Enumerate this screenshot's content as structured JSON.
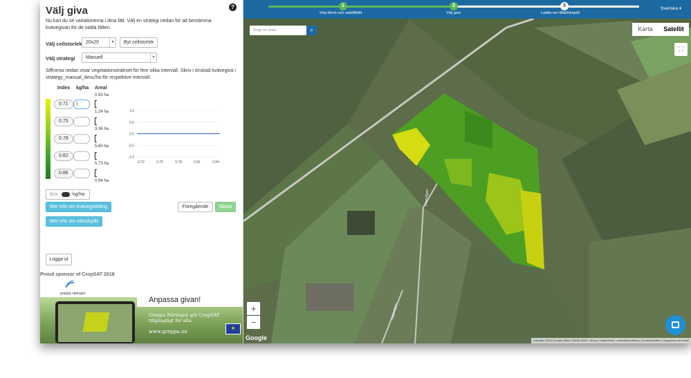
{
  "left": {
    "title": "Välj giva",
    "intro": "Nu kan du se variationerna i dina fält. Välj en strategi nedan för att bestämma kvävegivan för de valda fälten.",
    "cellsize_label": "Välj cellstorlek",
    "cellsize_value": "20x20",
    "change_cellsize_button": "Byt cellstorlek",
    "strategy_label": "Välj strategi",
    "strategy_value": "Manuell",
    "description": "Siffrorna nedan visar vegetationsindexet för fem olika intervall. Skriv i önskad kvävegiva i strategy_manual_desc/ha för respektive intervall.",
    "col_index": "Index",
    "col_kgha": "kg/ha",
    "col_areal": "Areal",
    "indexes": [
      "0.71",
      "0.75",
      "0.78",
      "0.82",
      "0.86"
    ],
    "areas": [
      "0.93 ha",
      "1.24 ha",
      "3.36 ha",
      "5.60 ha",
      "5.73 ha",
      "0.94 ha"
    ],
    "toggle_left": "lb/a",
    "toggle_right": "kg/ha",
    "more_info_n": "Mer info om kvävegödsling",
    "more_info_growth": "Mer info om växtskydd",
    "prev_button": "Föregående",
    "next_button": "Nästa",
    "logout_button": "Logga ut",
    "sponsor": "Proud sponsor of CropSAT 2018",
    "logo_text": "greppa näringen",
    "banner_title": "Anpassa givan!",
    "banner_sub": "Greppa Näringen gör CropSAT tillgängligt för alla.",
    "banner_url": "www.greppa.nu"
  },
  "chart_data": {
    "type": "line",
    "x": [
      "0.72",
      "0.75",
      "0.78",
      "0.81",
      "0.84"
    ],
    "y_ticks": [
      "1.0",
      "0.5",
      "0.0",
      "-0.5",
      "-1.0"
    ],
    "ylim": [
      -1.0,
      1.0
    ],
    "values": [
      0,
      0,
      0,
      0,
      0
    ],
    "line_color": "#2c5fbf"
  },
  "map": {
    "steps": [
      {
        "num": "1",
        "label": "Visa block och satellitbild"
      },
      {
        "num": "2",
        "label": "Välj giva"
      },
      {
        "num": "3",
        "label": "Ladda ner tilldelningsfil"
      }
    ],
    "language": "Svenska ▾",
    "search_placeholder": "Ange en plats",
    "map_type_map": "Karta",
    "map_type_satellite": "Satellit",
    "zoom_in": "+",
    "zoom_out": "−",
    "google": "Google",
    "attribution": "Kartdata ©2018 Google Bilder ©2018 CNES / Airbus, DigitalGlobe, Lantmäteriet/Metria | Användarvillkor | Rapportera ett kartfel",
    "road_label_1": "Linyrvägen",
    "road_label_2": "Lygavägen"
  },
  "colors": {
    "topbar": "#1d6aa3",
    "info_button": "#5bc0de",
    "next_button": "#92d492",
    "step_done": "#5cb85c"
  }
}
